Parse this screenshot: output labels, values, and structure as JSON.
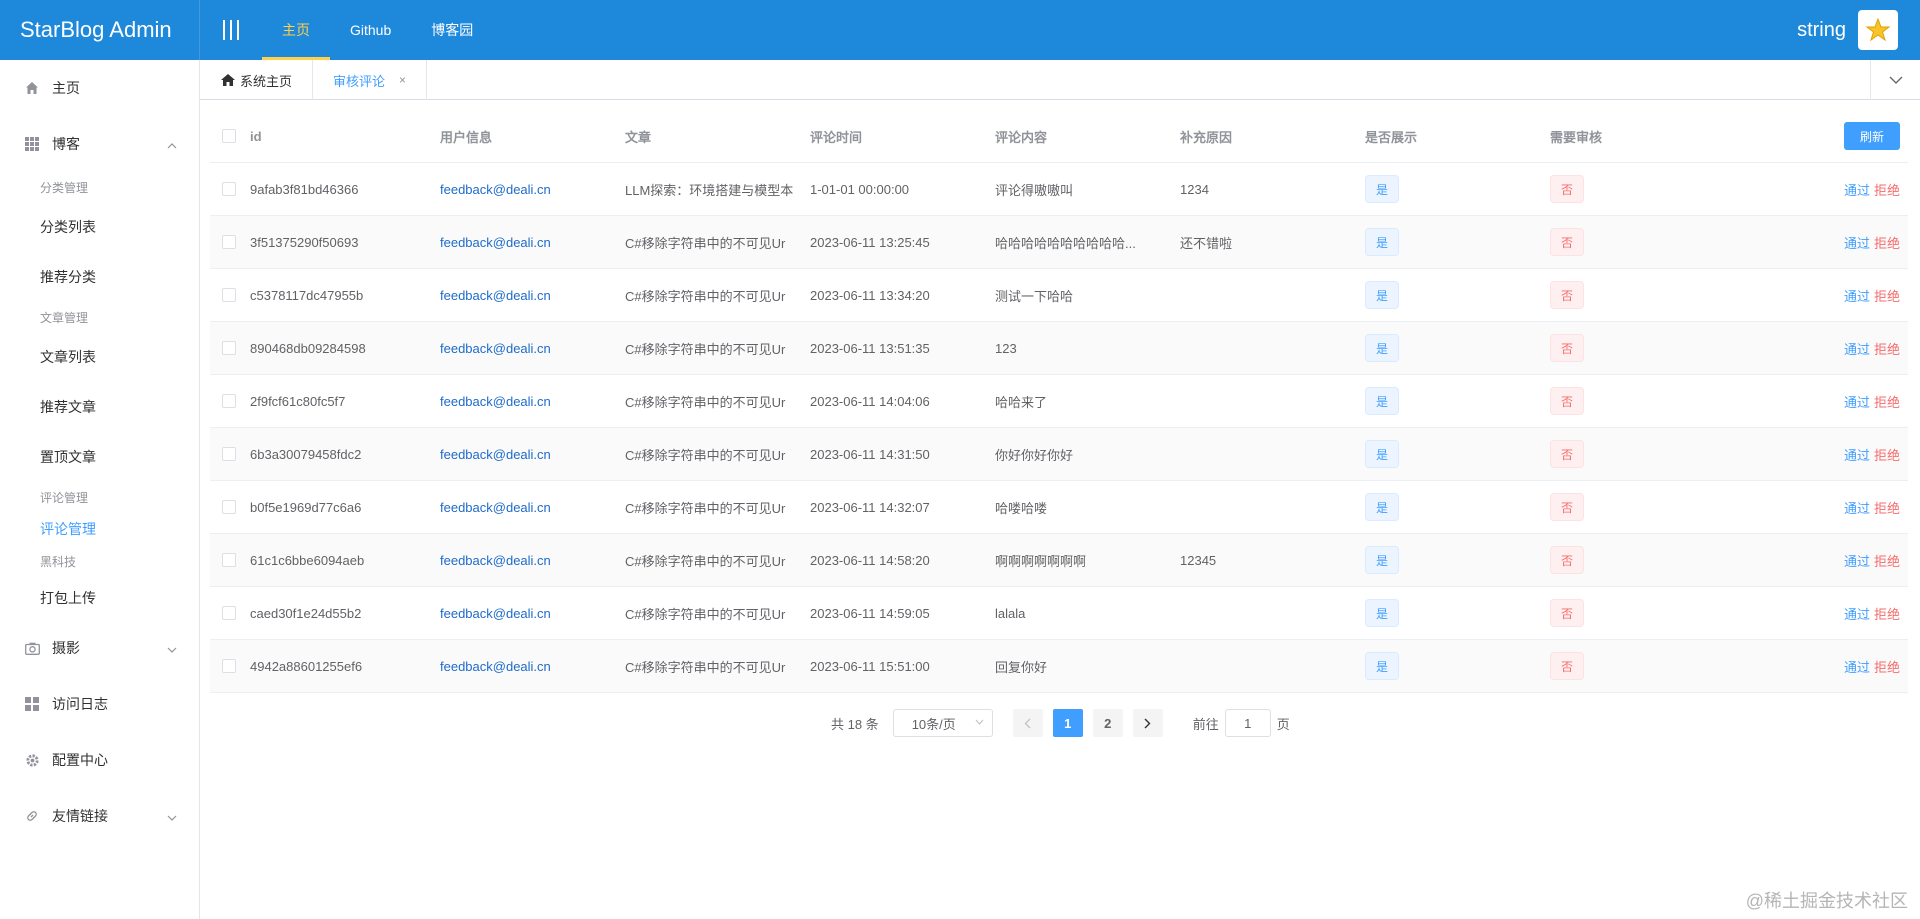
{
  "app": {
    "brand": "StarBlog Admin"
  },
  "topnav": {
    "items": [
      {
        "label": "主页",
        "active": true
      },
      {
        "label": "Github"
      },
      {
        "label": "博客园"
      }
    ]
  },
  "user": {
    "name": "string"
  },
  "sidebar": {
    "home": "主页",
    "blog": "博客",
    "groups": [
      {
        "title": "分类管理",
        "items": [
          "分类列表",
          "推荐分类"
        ]
      },
      {
        "title": "文章管理",
        "items": [
          "文章列表",
          "推荐文章",
          "置顶文章"
        ]
      },
      {
        "title": "评论管理",
        "items": [
          "评论管理"
        ]
      },
      {
        "title": "黑科技",
        "items": [
          "打包上传"
        ]
      }
    ],
    "photo": "摄影",
    "visitlog": "访问日志",
    "config": "配置中心",
    "links": "友情链接"
  },
  "tabs": [
    {
      "label": "系统主页"
    },
    {
      "label": "审核评论",
      "active": true
    }
  ],
  "table": {
    "headers": {
      "id": "id",
      "user": "用户信息",
      "article": "文章",
      "time": "评论时间",
      "content": "评论内容",
      "extra": "补充原因",
      "show": "是否展示",
      "audit": "需要审核"
    },
    "refresh_label": "刷新",
    "yes_label": "是",
    "no_label": "否",
    "pass_label": "通过",
    "reject_label": "拒绝",
    "rows": [
      {
        "id": "9afab3f81bd46366",
        "user": "feedback@deali.cn",
        "article": "LLM探索：环境搭建与模型本",
        "time": "1-01-01 00:00:00",
        "content": "评论得嗷嗷叫",
        "extra": "1234"
      },
      {
        "id": "3f51375290f50693",
        "user": "feedback@deali.cn",
        "article": "C#移除字符串中的不可见Ur",
        "time": "2023-06-11 13:25:45",
        "content": "哈哈哈哈哈哈哈哈哈哈...",
        "extra": "还不错啦"
      },
      {
        "id": "c5378117dc47955b",
        "user": "feedback@deali.cn",
        "article": "C#移除字符串中的不可见Ur",
        "time": "2023-06-11 13:34:20",
        "content": "测试一下哈哈",
        "extra": ""
      },
      {
        "id": "890468db09284598",
        "user": "feedback@deali.cn",
        "article": "C#移除字符串中的不可见Ur",
        "time": "2023-06-11 13:51:35",
        "content": "123",
        "extra": ""
      },
      {
        "id": "2f9fcf61c80fc5f7",
        "user": "feedback@deali.cn",
        "article": "C#移除字符串中的不可见Ur",
        "time": "2023-06-11 14:04:06",
        "content": "哈哈来了",
        "extra": ""
      },
      {
        "id": "6b3a30079458fdc2",
        "user": "feedback@deali.cn",
        "article": "C#移除字符串中的不可见Ur",
        "time": "2023-06-11 14:31:50",
        "content": "你好你好你好",
        "extra": ""
      },
      {
        "id": "b0f5e1969d77c6a6",
        "user": "feedback@deali.cn",
        "article": "C#移除字符串中的不可见Ur",
        "time": "2023-06-11 14:32:07",
        "content": "哈喽哈喽",
        "extra": ""
      },
      {
        "id": "61c1c6bbe6094aeb",
        "user": "feedback@deali.cn",
        "article": "C#移除字符串中的不可见Ur",
        "time": "2023-06-11 14:58:20",
        "content": "啊啊啊啊啊啊啊",
        "extra": "12345"
      },
      {
        "id": "caed30f1e24d55b2",
        "user": "feedback@deali.cn",
        "article": "C#移除字符串中的不可见Ur",
        "time": "2023-06-11 14:59:05",
        "content": "lalala",
        "extra": ""
      },
      {
        "id": "4942a88601255ef6",
        "user": "feedback@deali.cn",
        "article": "C#移除字符串中的不可见Ur",
        "time": "2023-06-11 15:51:00",
        "content": "回复你好",
        "extra": ""
      }
    ]
  },
  "pagination": {
    "total": "共 18 条",
    "page_size": "10条/页",
    "pages": [
      "1",
      "2"
    ],
    "current": "1",
    "goto_label": "前往",
    "goto_value": "1",
    "page_suffix": "页"
  },
  "watermark": "@稀土掘金技术社区",
  "colors": {
    "header": "#1e88db",
    "accent": "#409eff",
    "danger": "#f56c6c",
    "active_nav": "#ffd04b"
  }
}
